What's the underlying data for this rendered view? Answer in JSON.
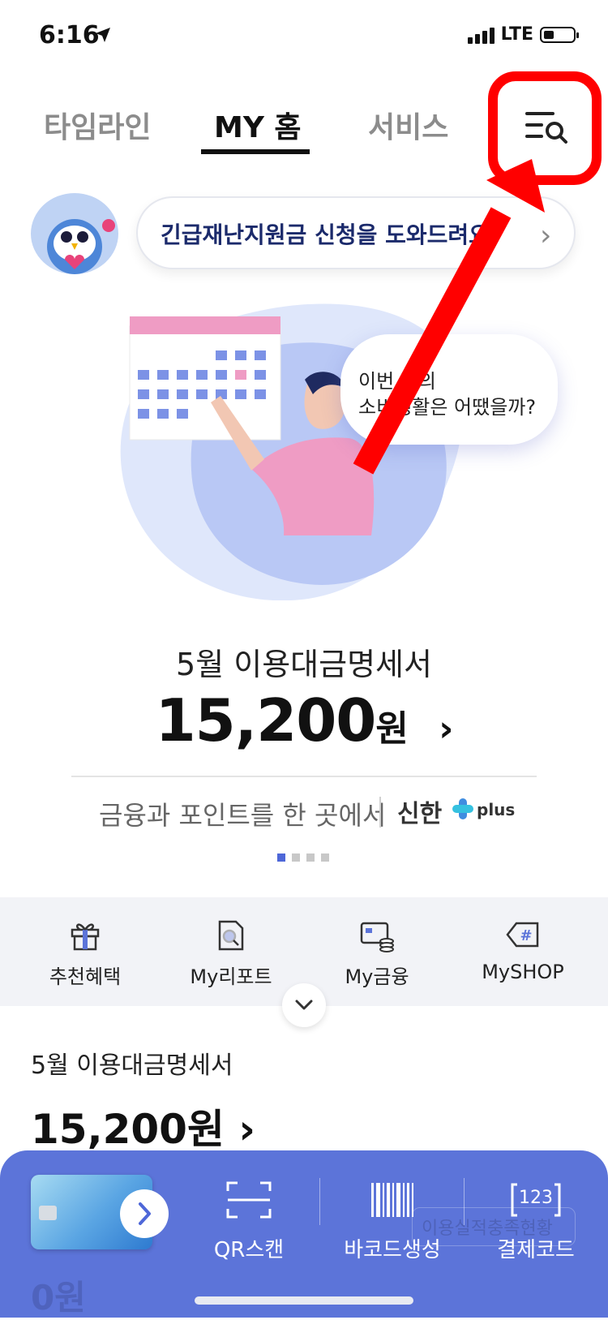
{
  "status_bar": {
    "time": "6:16",
    "network": "LTE"
  },
  "top_tabs": [
    {
      "label": "타임라인",
      "active": false
    },
    {
      "label": "MY 홈",
      "active": true
    },
    {
      "label": "서비스",
      "active": false
    }
  ],
  "notice": {
    "text": "긴급재난지원금 신청을 도와드려요!"
  },
  "hero": {
    "bubble_line1": "이번 달의",
    "bubble_line2": "소비생활은 어땠을까?",
    "statement_title": "5월 이용대금명세서",
    "statement_amount": "15,200",
    "statement_unit": "원"
  },
  "promo": {
    "text": "금융과 포인트를 한 곳에서",
    "brand": "신한",
    "brand_suffix": "plus"
  },
  "carousel": {
    "total": 4,
    "active": 0
  },
  "quick_menu": [
    {
      "label": "추천혜택",
      "icon": "gift-icon"
    },
    {
      "label": "My리포트",
      "icon": "report-search-icon"
    },
    {
      "label": "My금융",
      "icon": "wallet-coins-icon"
    },
    {
      "label": "MySHOP",
      "icon": "hash-tag-icon"
    }
  ],
  "statement_section": {
    "title": "5월 이용대금명세서",
    "amount": "15,200원"
  },
  "behind_bar": {
    "amount": "0원",
    "link": "이용실적충족현황"
  },
  "bottom_bar": [
    {
      "label": "QR스캔",
      "icon": "qr-scan-icon"
    },
    {
      "label": "바코드생성",
      "icon": "barcode-icon"
    },
    {
      "label": "결제코드",
      "icon": "payment-code-icon",
      "icon_text": "123"
    }
  ],
  "colors": {
    "accent": "#5c74d9",
    "highlight": "#ff0000",
    "navy": "#1b2a6b",
    "pink": "#ef9cc4"
  }
}
